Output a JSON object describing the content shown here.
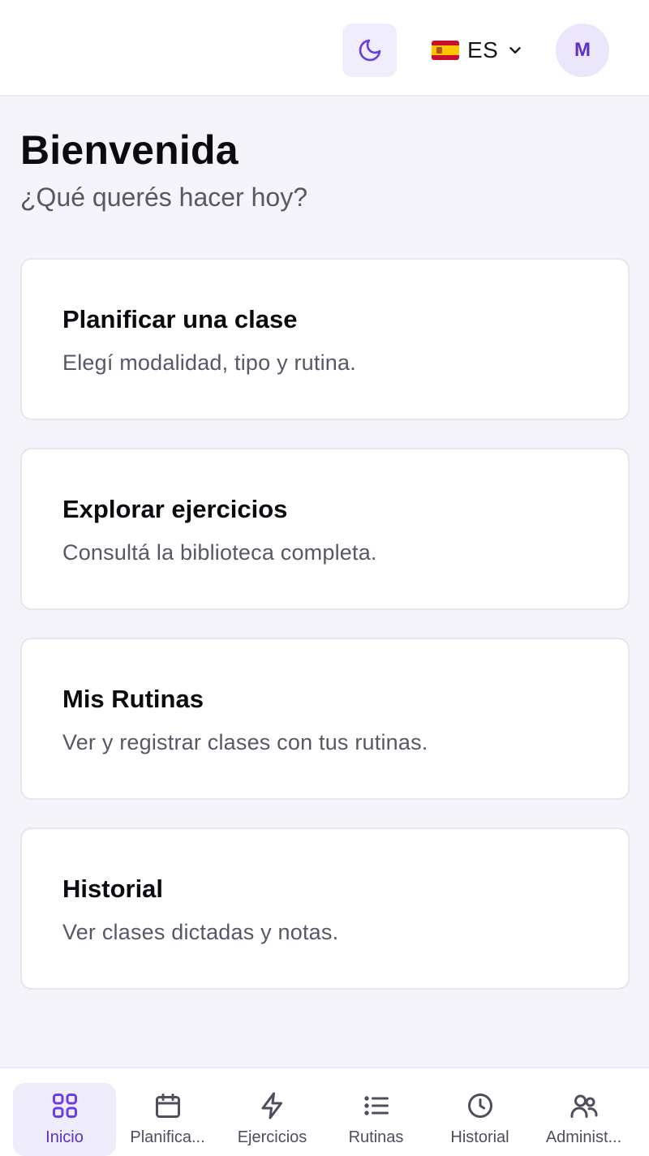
{
  "header": {
    "theme_icon": "moon-icon",
    "language": {
      "code": "ES",
      "flag_icon": "spain-flag-icon",
      "chevron_icon": "chevron-down-icon"
    },
    "avatar_initial": "M"
  },
  "page": {
    "title": "Bienvenida",
    "subtitle": "¿Qué querés hacer hoy?"
  },
  "cards": [
    {
      "title": "Planificar una clase",
      "description": "Elegí modalidad, tipo y rutina."
    },
    {
      "title": "Explorar ejercicios",
      "description": "Consultá la biblioteca completa."
    },
    {
      "title": "Mis Rutinas",
      "description": "Ver y registrar clases con tus rutinas."
    },
    {
      "title": "Historial",
      "description": "Ver clases dictadas y notas."
    }
  ],
  "bottom_nav": {
    "active": "Inicio",
    "items": [
      {
        "label": "Inicio",
        "icon": "grid-icon"
      },
      {
        "label": "Planifica...",
        "icon": "calendar-icon"
      },
      {
        "label": "Ejercicios",
        "icon": "lightning-icon"
      },
      {
        "label": "Rutinas",
        "icon": "list-icon"
      },
      {
        "label": "Historial",
        "icon": "clock-icon"
      },
      {
        "label": "Administ...",
        "icon": "users-icon"
      }
    ]
  },
  "colors": {
    "accent": "#5b2fcc",
    "accent_soft": "#efecfc",
    "background": "#f5f4fb",
    "card": "#ffffff",
    "muted_text": "#565866"
  }
}
